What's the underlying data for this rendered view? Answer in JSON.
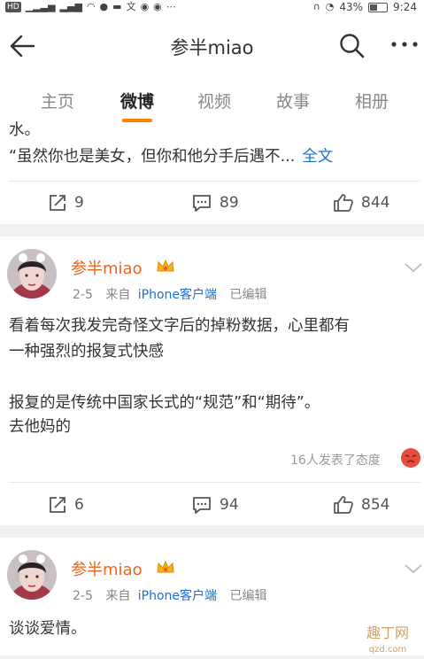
{
  "status_bar": {
    "left_badges": [
      "HD",
      "4G"
    ],
    "left_chars": [
      "文"
    ],
    "battery": "43%",
    "time": "9:24"
  },
  "header": {
    "title": "参半miao"
  },
  "tabs": [
    {
      "label": "主页",
      "active": false
    },
    {
      "label": "微博",
      "active": true
    },
    {
      "label": "视频",
      "active": false
    },
    {
      "label": "故事",
      "active": false
    },
    {
      "label": "相册",
      "active": false
    }
  ],
  "post1": {
    "line_top": "水。",
    "line_main": "“虽然你也是美女，但你和他分手后遇不...",
    "full_text_link": "全文",
    "reposts": "9",
    "comments": "89",
    "likes": "844"
  },
  "post2": {
    "username": "参半miao",
    "date": "2-5",
    "from_label": "来自",
    "source": "iPhone客户端",
    "edited": "已编辑",
    "text_lines": [
      "看着每次我发完奇怪文字后的掉粉数据，心里都有",
      "一种强烈的报复式快感",
      "",
      "报复的是传统中国家长式的“规范”和“期待”。",
      "去他妈的"
    ],
    "reaction_text": "16人发表了态度",
    "reposts": "6",
    "comments": "94",
    "likes": "854"
  },
  "post3": {
    "username": "参半miao",
    "date": "2-5",
    "from_label": "来自",
    "source": "iPhone客户端",
    "edited": "已编辑",
    "text": "谈谈爱情。"
  },
  "watermark": {
    "text": "趣丁网",
    "sub": "qzd.com"
  },
  "colors": {
    "accent": "#ff8200",
    "username": "#e86722",
    "link": "#1f6fd0"
  }
}
